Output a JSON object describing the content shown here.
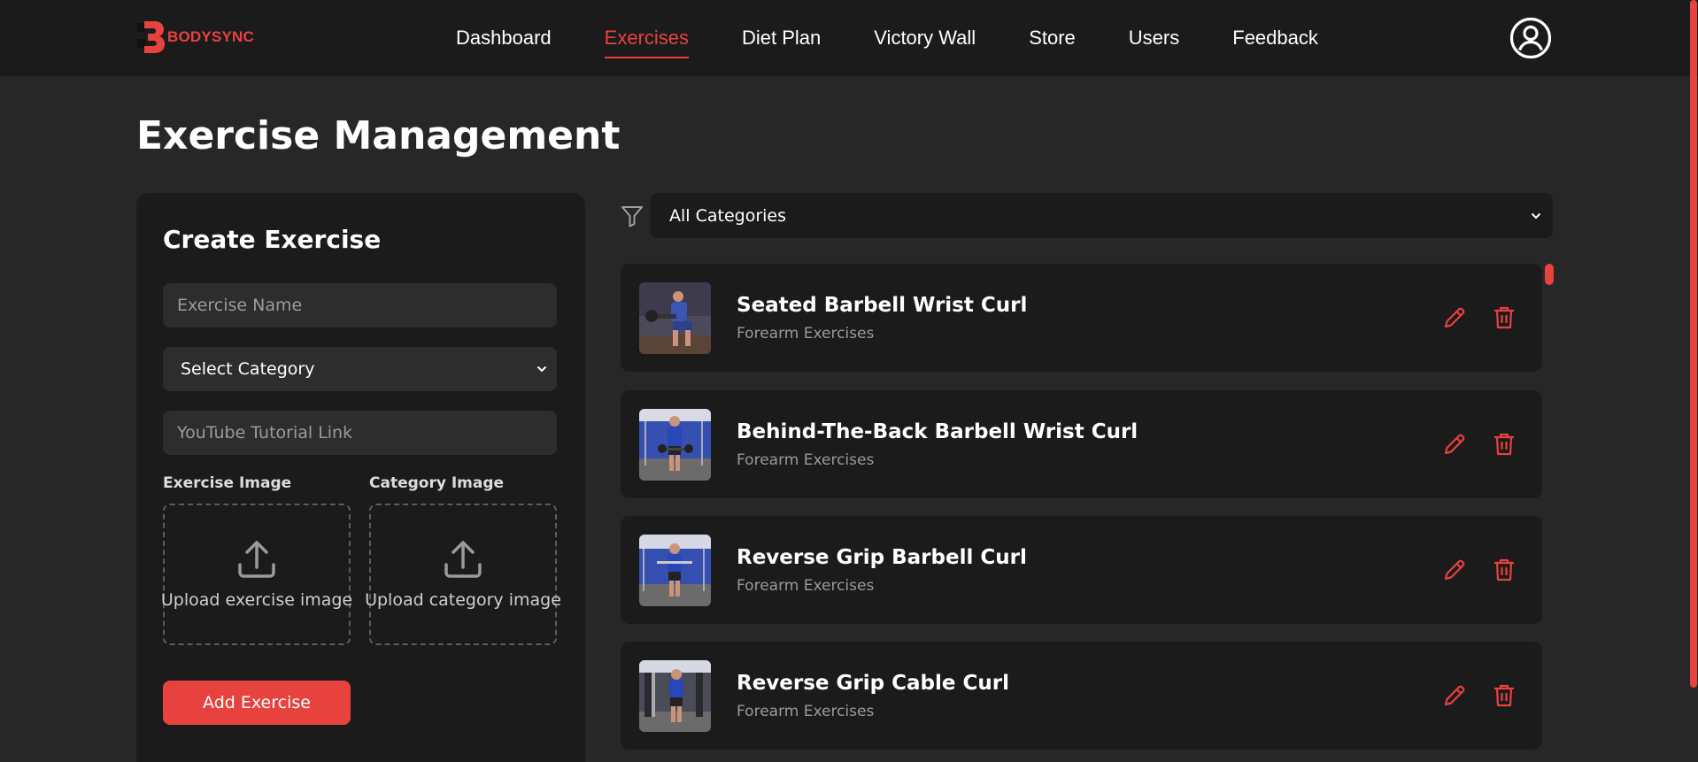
{
  "brand": {
    "name": "BODYSYNC",
    "accent": "#e8423f"
  },
  "nav": {
    "items": [
      {
        "label": "Dashboard"
      },
      {
        "label": "Exercises",
        "active": true
      },
      {
        "label": "Diet Plan"
      },
      {
        "label": "Victory Wall"
      },
      {
        "label": "Store"
      },
      {
        "label": "Users"
      },
      {
        "label": "Feedback"
      }
    ],
    "profile_icon": "user-circle-icon"
  },
  "page": {
    "title": "Exercise Management"
  },
  "create_form": {
    "title": "Create Exercise",
    "name_placeholder": "Exercise Name",
    "category_select": "Select Category",
    "youtube_placeholder": "YouTube Tutorial Link",
    "exercise_image_label": "Exercise Image",
    "category_image_label": "Category Image",
    "upload_exercise_text": "Upload exercise image",
    "upload_category_text": "Upload category image",
    "add_button": "Add Exercise"
  },
  "filter": {
    "icon": "filter-icon",
    "selected": "All Categories"
  },
  "exercises": [
    {
      "name": "Seated Barbell Wrist Curl",
      "category": "Forearm Exercises"
    },
    {
      "name": "Behind-The-Back Barbell Wrist Curl",
      "category": "Forearm Exercises"
    },
    {
      "name": "Reverse Grip Barbell Curl",
      "category": "Forearm Exercises"
    },
    {
      "name": "Reverse Grip Cable Curl",
      "category": "Forearm Exercises"
    }
  ]
}
